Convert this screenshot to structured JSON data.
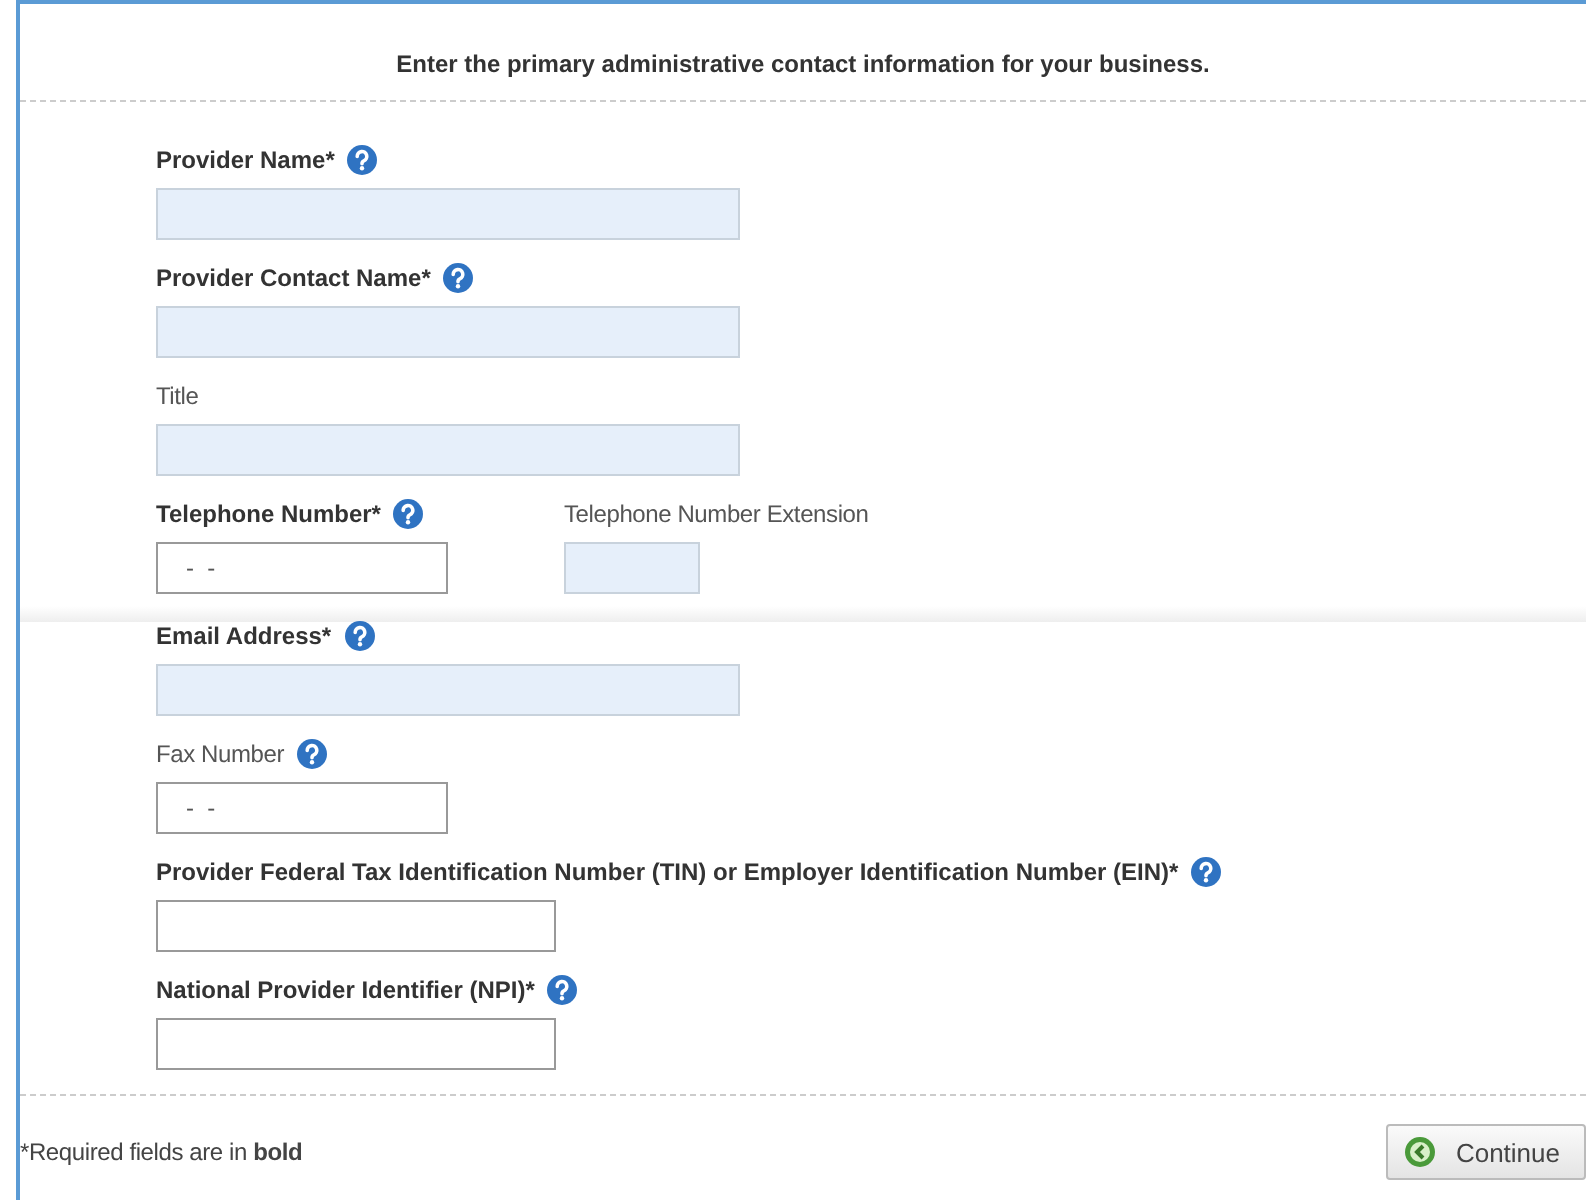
{
  "intro": "Enter the primary administrative contact information for your business.",
  "rows": [
    {
      "fields": [
        {
          "label": "Provider Name*",
          "required": true,
          "help": true,
          "kind": "text",
          "shaded": true
        }
      ]
    },
    {
      "fields": [
        {
          "label": "Provider Contact Name*",
          "required": true,
          "help": true,
          "kind": "text",
          "shaded": true
        }
      ]
    },
    {
      "fields": [
        {
          "label": "Title",
          "required": false,
          "help": false,
          "kind": "text",
          "shaded": true
        }
      ]
    },
    {
      "fields": [
        {
          "label": "Telephone Number*",
          "required": true,
          "help": true,
          "kind": "phone",
          "shaded": false,
          "value": "-  -"
        },
        {
          "label": "Telephone Number Extension",
          "required": false,
          "help": false,
          "kind": "extension",
          "shaded": true
        }
      ]
    },
    {
      "fields": [
        {
          "label": "Email Address*",
          "required": true,
          "help": true,
          "kind": "text",
          "shaded": true
        }
      ]
    },
    {
      "fields": [
        {
          "label": "Fax Number",
          "required": false,
          "help": true,
          "kind": "phone",
          "shaded": false,
          "value": "-  -"
        }
      ]
    },
    {
      "fields": [
        {
          "label": "Provider Federal Tax Identification Number (TIN) or Employer Identification Number (EIN)*",
          "required": true,
          "help": true,
          "kind": "number",
          "shaded": false
        }
      ]
    },
    {
      "fields": [
        {
          "label": "National Provider Identifier (NPI)*",
          "required": true,
          "help": true,
          "kind": "number",
          "shaded": false
        }
      ]
    }
  ],
  "footnote": "*Required fields are in **bold**",
  "continue_button": "Continue"
}
